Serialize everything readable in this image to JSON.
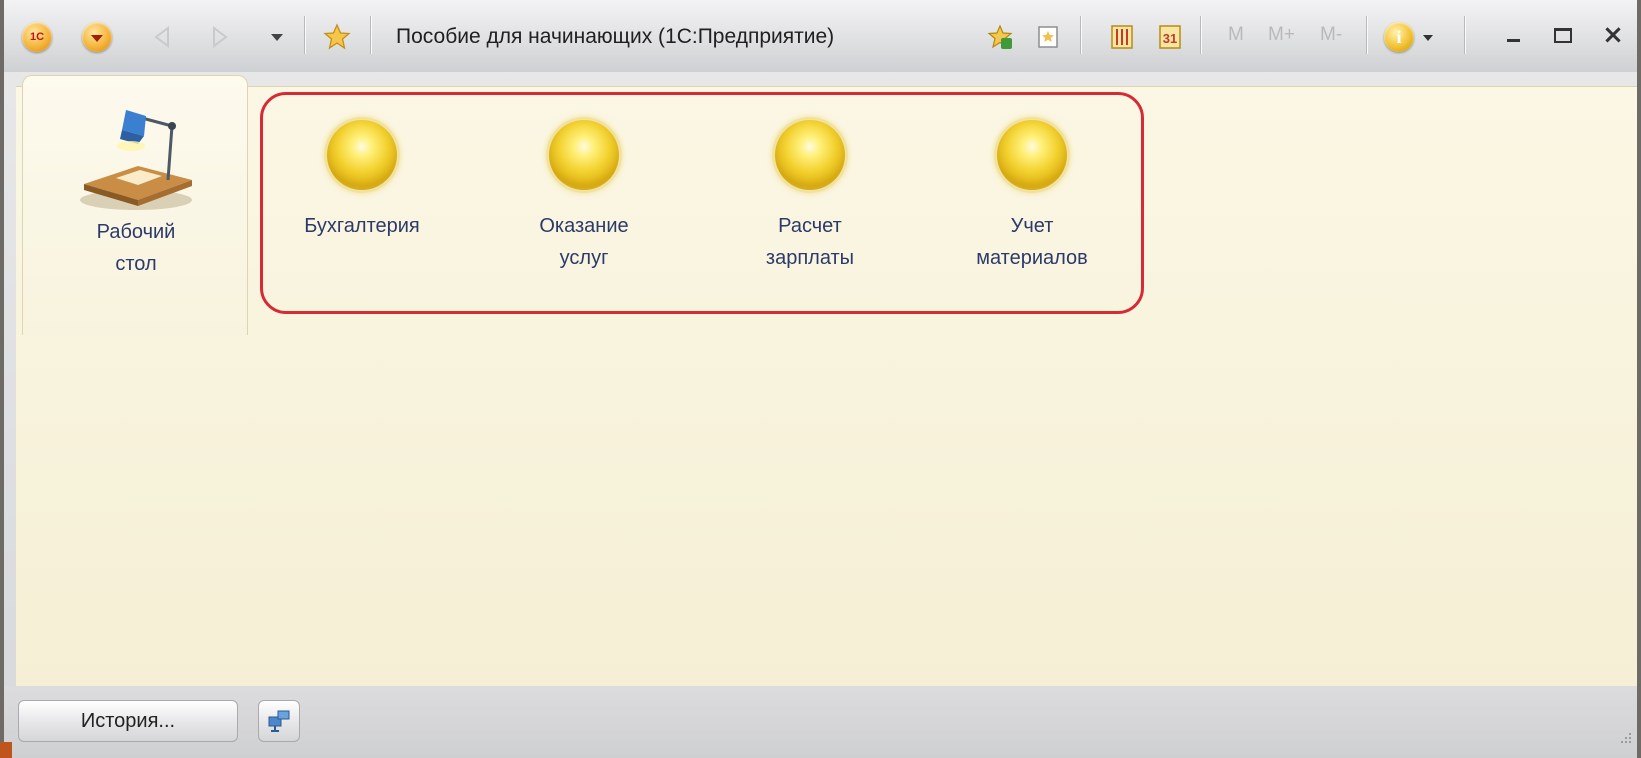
{
  "window": {
    "title": "Пособие для начинающих  (1С:Предприятие)",
    "logo_text": "1С"
  },
  "toolbar": {
    "m_label": "M",
    "m_plus_label": "M+",
    "m_minus_label": "M-",
    "info_label": "i"
  },
  "sections": [
    {
      "label": "Рабочий\nстол",
      "icon": "desk-lamp-icon"
    },
    {
      "label": "Бухгалтерия",
      "icon": "yellow-orb-icon"
    },
    {
      "label": "Оказание\nуслуг",
      "icon": "yellow-orb-icon"
    },
    {
      "label": "Расчет\nзарплаты",
      "icon": "yellow-orb-icon"
    },
    {
      "label": "Учет\nматериалов",
      "icon": "yellow-orb-icon"
    }
  ],
  "statusbar": {
    "history_label": "История..."
  },
  "colors": {
    "highlight_frame": "#d62a35",
    "content_background": "#fbf7e4",
    "section_label": "#2c3a6a"
  }
}
